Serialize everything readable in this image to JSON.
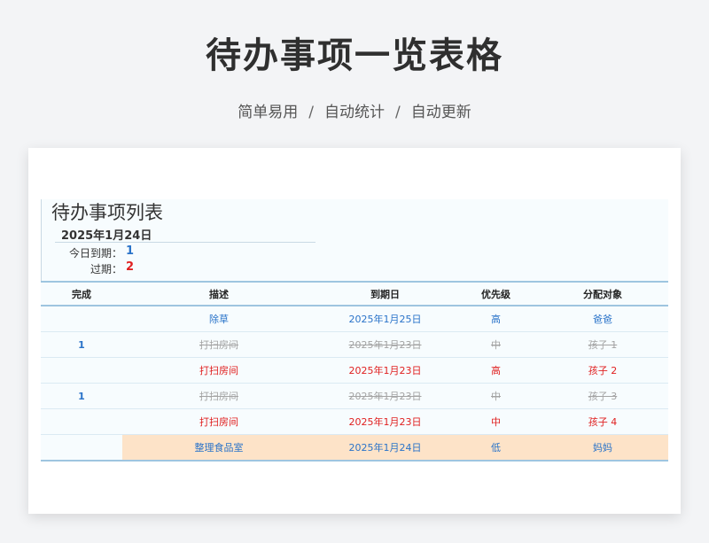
{
  "page": {
    "title": "待办事项一览表格",
    "subtitle_parts": [
      "简单易用",
      "自动统计",
      "自动更新"
    ],
    "subtitle_sep": "/"
  },
  "sheet": {
    "title": "待办事项列表",
    "date": "2025年1月24日",
    "due_today_label": "今日到期：",
    "due_today_value": "1",
    "overdue_label": "过期：",
    "overdue_value": "2"
  },
  "table": {
    "headers": {
      "done": "完成",
      "description": "描述",
      "due_date": "到期日",
      "priority": "优先级",
      "assignee": "分配对象"
    },
    "rows": [
      {
        "done": "",
        "description": "除草",
        "due_date": "2025年1月25日",
        "priority": "高",
        "assignee": "爸爸",
        "status": "normal"
      },
      {
        "done": "1",
        "description": "打扫房间",
        "due_date": "2025年1月23日",
        "priority": "中",
        "assignee": "孩子 1",
        "status": "done"
      },
      {
        "done": "",
        "description": "打扫房间",
        "due_date": "2025年1月23日",
        "priority": "高",
        "assignee": "孩子 2",
        "status": "overdue"
      },
      {
        "done": "1",
        "description": "打扫房间",
        "due_date": "2025年1月23日",
        "priority": "中",
        "assignee": "孩子 3",
        "status": "done"
      },
      {
        "done": "",
        "description": "打扫房间",
        "due_date": "2025年1月23日",
        "priority": "中",
        "assignee": "孩子 4",
        "status": "overdue"
      },
      {
        "done": "",
        "description": "整理食品室",
        "due_date": "2025年1月24日",
        "priority": "低",
        "assignee": "妈妈",
        "status": "highlight"
      }
    ]
  },
  "colors": {
    "normal": "#2a73c9",
    "overdue": "#e02020",
    "done": "#a3a3a3",
    "highlight_bg": "#fde3c8"
  }
}
